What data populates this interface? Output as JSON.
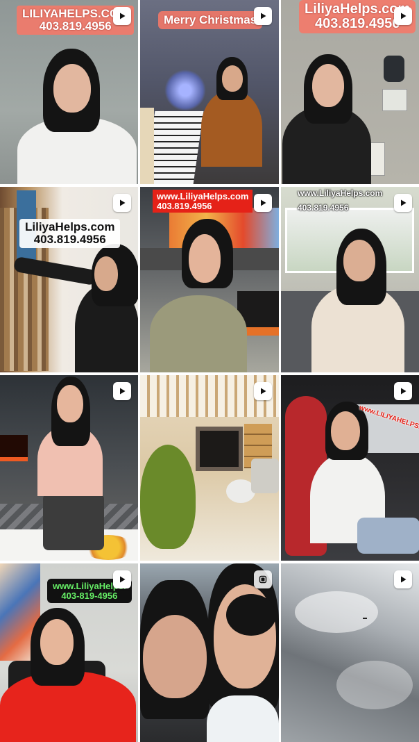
{
  "feed": {
    "tiles": [
      {
        "overlay_line1": "LILIYAHELPS.COM",
        "overlay_line2": "403.819.4956",
        "icon": "play-icon"
      },
      {
        "overlay_line1": "Merry Christmas",
        "icon": "play-icon"
      },
      {
        "overlay_line1": "LiliyaHelps.com",
        "overlay_line2": "403.819.4956",
        "icon": "play-icon"
      },
      {
        "overlay_line1": "LiliyaHelps.com",
        "overlay_line2": "403.819.4956",
        "icon": "play-icon"
      },
      {
        "overlay_line1": "www.LiliyaHelps.com",
        "overlay_line2": "403.819.4956",
        "icon": "play-icon"
      },
      {
        "overlay_line1": "www.LiliyaHelps.com",
        "overlay_line2": "403.819.4956",
        "icon": "play-icon"
      },
      {
        "icon": "play-icon"
      },
      {
        "icon": "play-icon"
      },
      {
        "overlay_line1": "www.LILIYAHELPS.COM",
        "icon": "play-icon"
      },
      {
        "overlay_line1": "www.LiliyaHelps.",
        "overlay_line2": "403-819-4956",
        "icon": "play-icon"
      },
      {
        "icon": "multi-image-icon"
      },
      {
        "icon": "play-icon"
      }
    ]
  },
  "colors": {
    "overlay_pink": "#f67868",
    "overlay_red": "#e52218",
    "overlay_green_text": "#66ee66",
    "hair": "#141414"
  }
}
